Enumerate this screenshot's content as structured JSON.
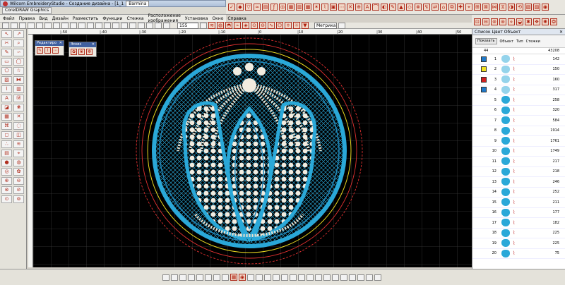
{
  "window": {
    "title": "Wilcom EmbroideryStudio - Создание дизайна - [1_1",
    "document_tab": "Barmina"
  },
  "tabs": [
    "CorelDRAW Graphics"
  ],
  "menu": [
    "Файл",
    "Правка",
    "Вид",
    "Дизайн",
    "Разместить",
    "Функции",
    "Стежка",
    "Расположение изображения",
    "Установка",
    "Окно",
    "Справка"
  ],
  "toolbar": {
    "zoom_value": "155",
    "zoom_value2": "155",
    "unit": "Метрика"
  },
  "rulers": {
    "h_ticks": [
      "-50",
      "-40",
      "-30",
      "-20",
      "-10",
      "0",
      "10",
      "20",
      "30",
      "40",
      "50"
    ]
  },
  "panels": {
    "editor": {
      "title": "Редактиро"
    },
    "sketches": {
      "title": "Эскиз"
    }
  },
  "objects_panel": {
    "title": "Список Цвет Объект",
    "show_button": "Показать",
    "columns": {
      "object": "Объект",
      "type": "Тип",
      "stitches": "Стежки"
    },
    "total_number": "44",
    "total_stitches": "43208",
    "rows": [
      {
        "num": "1",
        "color": "#1f78c8",
        "stitches": "142"
      },
      {
        "num": "2",
        "color": "#f0e020",
        "stitches": "150"
      },
      {
        "num": "3",
        "color": "#d02020",
        "stitches": "160"
      },
      {
        "num": "4",
        "color": "#1f78c8",
        "stitches": "317"
      },
      {
        "num": "5",
        "stitches": "258"
      },
      {
        "num": "6",
        "stitches": "320"
      },
      {
        "num": "7",
        "stitches": "584"
      },
      {
        "num": "8",
        "stitches": "1914"
      },
      {
        "num": "9",
        "stitches": "1761"
      },
      {
        "num": "10",
        "stitches": "1749"
      },
      {
        "num": "11",
        "stitches": "217"
      },
      {
        "num": "12",
        "stitches": "218"
      },
      {
        "num": "13",
        "stitches": "246"
      },
      {
        "num": "14",
        "stitches": "252"
      },
      {
        "num": "15",
        "stitches": "211"
      },
      {
        "num": "16",
        "stitches": "177"
      },
      {
        "num": "17",
        "stitches": "182"
      },
      {
        "num": "18",
        "stitches": "225"
      },
      {
        "num": "19",
        "stitches": "225"
      },
      {
        "num": "20",
        "stitches": "75"
      }
    ]
  },
  "colors": {
    "canvas": "#000000",
    "design_blue": "#2aa8d8",
    "grid": "#3a3a3a",
    "pearl": "#f2ece0",
    "hoop_red": "#e03030",
    "hoop_yellow": "#e8d820"
  }
}
